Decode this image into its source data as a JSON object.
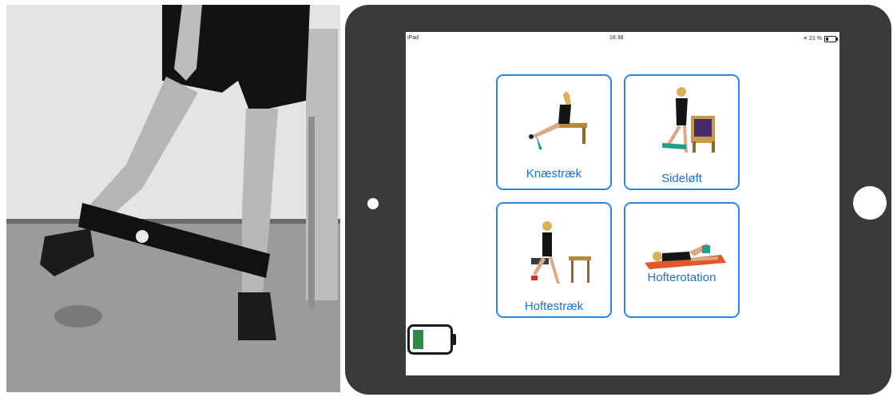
{
  "status_bar": {
    "carrier": "iPad",
    "time": "16.38",
    "battery_text": "✳ 21 %"
  },
  "tiles": [
    {
      "label": "Knæstræk",
      "icon": "knee-stretch-exercise-image"
    },
    {
      "label": "Sideløft",
      "icon": "side-lift-exercise-image"
    },
    {
      "label": "Hoftestræk",
      "icon": "hip-stretch-exercise-image"
    },
    {
      "label": "Hofterotation",
      "icon": "hip-rotation-exercise-image"
    }
  ],
  "battery_widget": {
    "level": 0.3,
    "color": "#2e8b46"
  },
  "colors": {
    "accent": "#2f86e0",
    "tablet_frame": "#3a3a3a"
  }
}
